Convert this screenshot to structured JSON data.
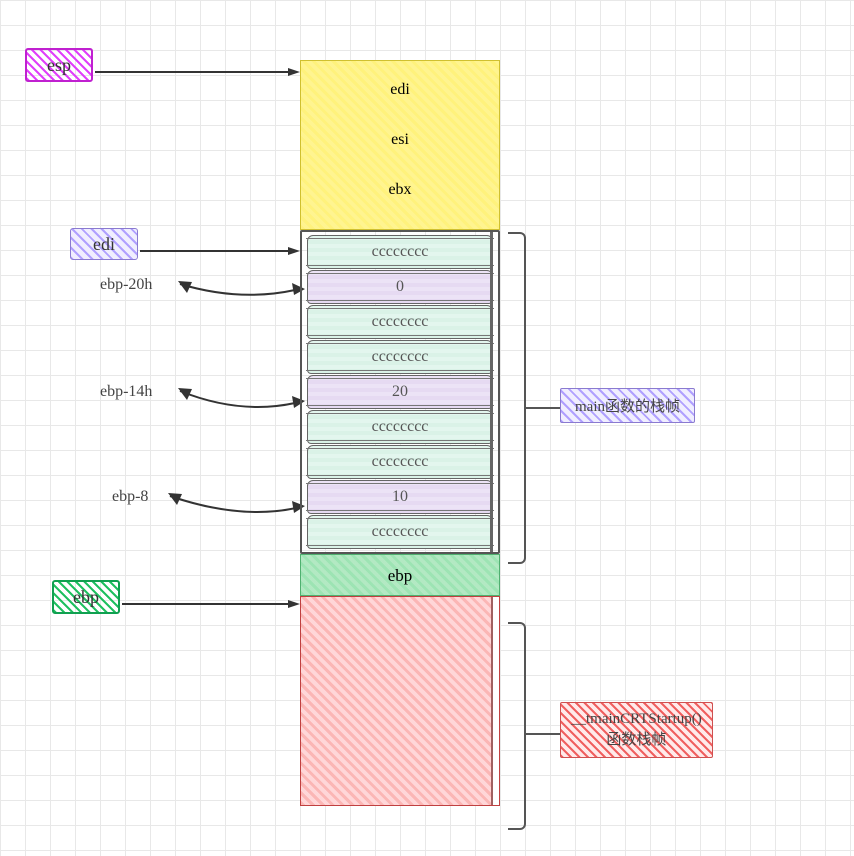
{
  "pointers": {
    "esp": "esp",
    "edi": "edi",
    "ebp": "ebp"
  },
  "offsets": {
    "ebp_20h": "ebp-20h",
    "ebp_14h": "ebp-14h",
    "ebp_8": "ebp-8"
  },
  "yellow": {
    "edi": "edi",
    "esi": "esi",
    "ebx": "ebx"
  },
  "stack": {
    "row0": "cccccccc",
    "row1": "0",
    "row2": "cccccccc",
    "row3": "cccccccc",
    "row4": "20",
    "row5": "cccccccc",
    "row6": "cccccccc",
    "row7": "10",
    "row8": "cccccccc"
  },
  "saved_ebp": "ebp",
  "labels": {
    "main_frame": "main函数的栈帧",
    "crt_frame_line1": "__tmainCRTStartup()",
    "crt_frame_line2": "函数栈帧"
  }
}
